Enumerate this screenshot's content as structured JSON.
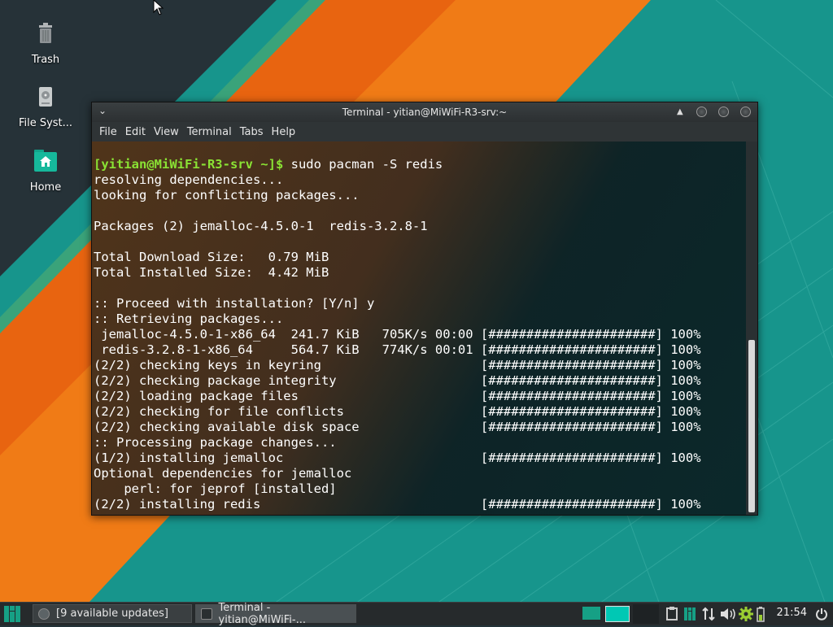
{
  "desktop": {
    "icons": [
      {
        "label": "Trash",
        "icon": "trash-icon"
      },
      {
        "label": "File Syst...",
        "icon": "drive-icon"
      },
      {
        "label": "Home",
        "icon": "home-folder-icon"
      }
    ]
  },
  "terminal": {
    "title": "Terminal - yitian@MiWiFi-R3-srv:~",
    "menu": [
      "File",
      "Edit",
      "View",
      "Terminal",
      "Tabs",
      "Help"
    ],
    "prompt": "[yitian@MiWiFi-R3-srv ~]$",
    "command": " sudo pacman -S redis",
    "output": [
      "resolving dependencies...",
      "looking for conflicting packages...",
      "",
      "Packages (2) jemalloc-4.5.0-1  redis-3.2.8-1",
      "",
      "Total Download Size:   0.79 MiB",
      "Total Installed Size:  4.42 MiB",
      "",
      ":: Proceed with installation? [Y/n] y",
      ":: Retrieving packages...",
      " jemalloc-4.5.0-1-x86_64  241.7 KiB   705K/s 00:00 [######################] 100%",
      " redis-3.2.8-1-x86_64     564.7 KiB   774K/s 00:01 [######################] 100%",
      "(2/2) checking keys in keyring                     [######################] 100%",
      "(2/2) checking package integrity                   [######################] 100%",
      "(2/2) loading package files                        [######################] 100%",
      "(2/2) checking for file conflicts                  [######################] 100%",
      "(2/2) checking available disk space                [######################] 100%",
      ":: Processing package changes...",
      "(1/2) installing jemalloc                          [######################] 100%",
      "Optional dependencies for jemalloc",
      "    perl: for jeprof [installed]",
      "(2/2) installing redis                             [######################] 100%"
    ]
  },
  "taskbar": {
    "tasks": [
      {
        "label": "[9 available updates]",
        "icon": "update-icon"
      },
      {
        "label": "Terminal - yitian@MiWiFi-...",
        "icon": "terminal-icon"
      }
    ],
    "tray_icons": [
      "workspace-1-icon",
      "workspace-2-icon",
      "clipboard-icon",
      "manjaro-settings-icon",
      "network-icon",
      "volume-icon",
      "settings-gear-icon",
      "battery-icon"
    ],
    "clock": "21:54",
    "colors": {
      "accent": "#16a085",
      "workspace_active": "#00c8b4"
    }
  }
}
